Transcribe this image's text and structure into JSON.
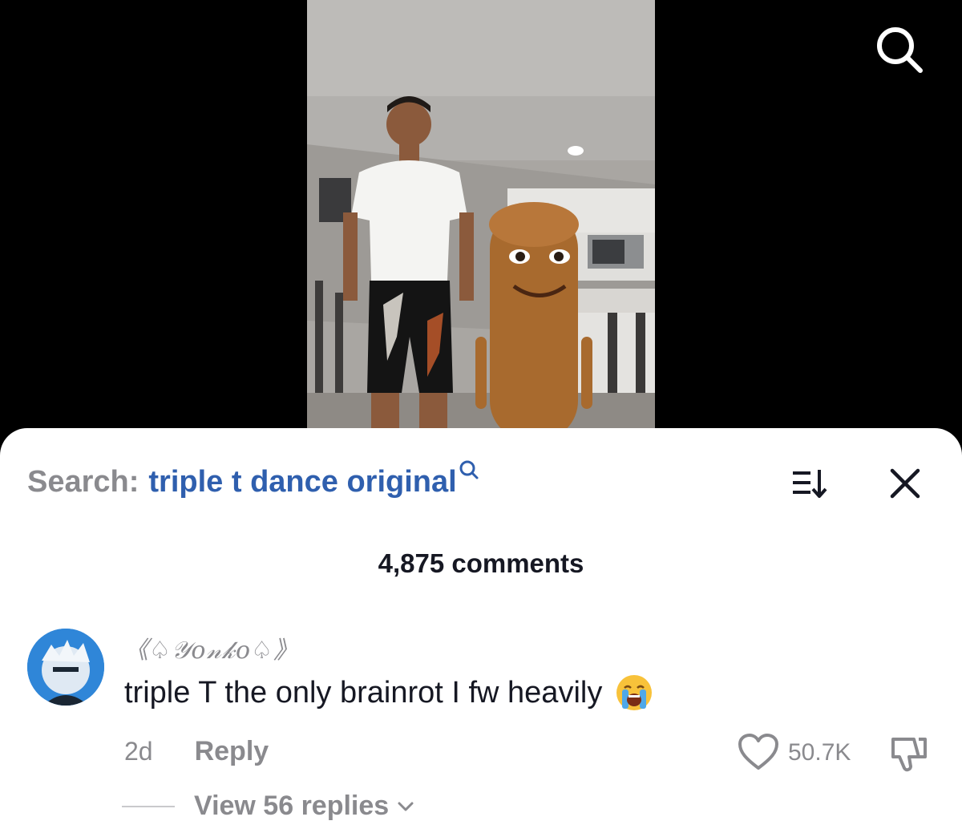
{
  "search": {
    "prefix": "Search:",
    "query": "triple t dance original"
  },
  "comments_header": {
    "count": "4,875 comments"
  },
  "comment": {
    "username": "《♤𝒴𝑜𝓃𝓀𝑜♤》",
    "text": "triple T the only brainrot I fw heavily",
    "time": "2d",
    "reply_label": "Reply",
    "like_count": "50.7K",
    "view_replies_label": "View 56 replies",
    "emoji": "loudly-crying-face"
  },
  "icons": {
    "top_search": "search-icon",
    "sort": "sort-icon",
    "close": "close-icon",
    "like": "heart-icon",
    "dislike": "thumbs-down-icon"
  },
  "colors": {
    "query_link": "#2f5fae",
    "muted_text": "#8a8a8e",
    "primary_text": "#161823",
    "sheet_background": "#ffffff"
  }
}
